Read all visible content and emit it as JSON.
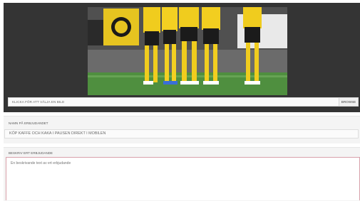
{
  "image_upload": {
    "placeholder": "KLICKA FÖR ATT VÄLJA EN BILD",
    "browse_label": "BROWSE"
  },
  "offer_name": {
    "label": "NAMN PÅ ERBJUDANDET",
    "value": "KÖP KAFFE OCH KAKA I PAUSEN DIREKT I MOBILEN"
  },
  "offer_description": {
    "label": "BESKRIV ERT ERBJUDANDE",
    "value": "En beskrivande text av ert erbjudande"
  }
}
